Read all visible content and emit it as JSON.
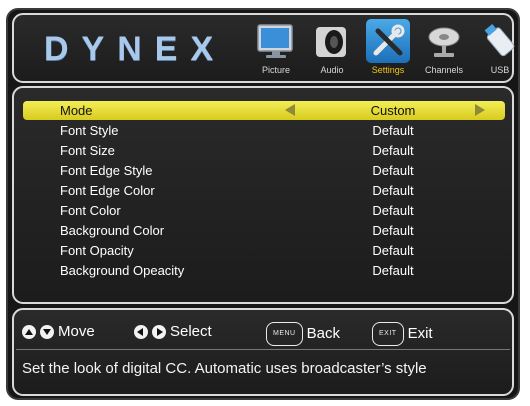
{
  "brand": {
    "logo_text": "DYNEX"
  },
  "menu": {
    "tabs": [
      {
        "label": "Picture",
        "icon": "monitor-icon",
        "active": false
      },
      {
        "label": "Audio",
        "icon": "speaker-icon",
        "active": false
      },
      {
        "label": "Settings",
        "icon": "tools-icon",
        "active": true
      },
      {
        "label": "Channels",
        "icon": "satellite-dish-icon",
        "active": false
      },
      {
        "label": "USB",
        "icon": "usb-drive-icon",
        "active": false
      }
    ]
  },
  "settings": {
    "rows": [
      {
        "name": "Mode",
        "value": "Custom"
      },
      {
        "name": "Font Style",
        "value": "Default"
      },
      {
        "name": "Font Size",
        "value": "Default"
      },
      {
        "name": "Font Edge Style",
        "value": "Default"
      },
      {
        "name": "Font Edge Color",
        "value": "Default"
      },
      {
        "name": "Font Color",
        "value": "Default"
      },
      {
        "name": "Background Color",
        "value": "Default"
      },
      {
        "name": "Font Opacity",
        "value": "Default"
      },
      {
        "name": "Background Opeacity",
        "value": "Default"
      }
    ]
  },
  "help": {
    "move": "Move",
    "select": "Select",
    "menu_key": "MENU",
    "back": "Back",
    "exit_key": "EXIT",
    "exit": "Exit",
    "description": "Set the look of digital CC. Automatic uses broadcaster’s style"
  },
  "colors": {
    "selected_row": "#e8df3a",
    "active_tab_label": "#f0c419",
    "logo": "#a8c8ec",
    "panel_border": "#d9d9d9"
  }
}
